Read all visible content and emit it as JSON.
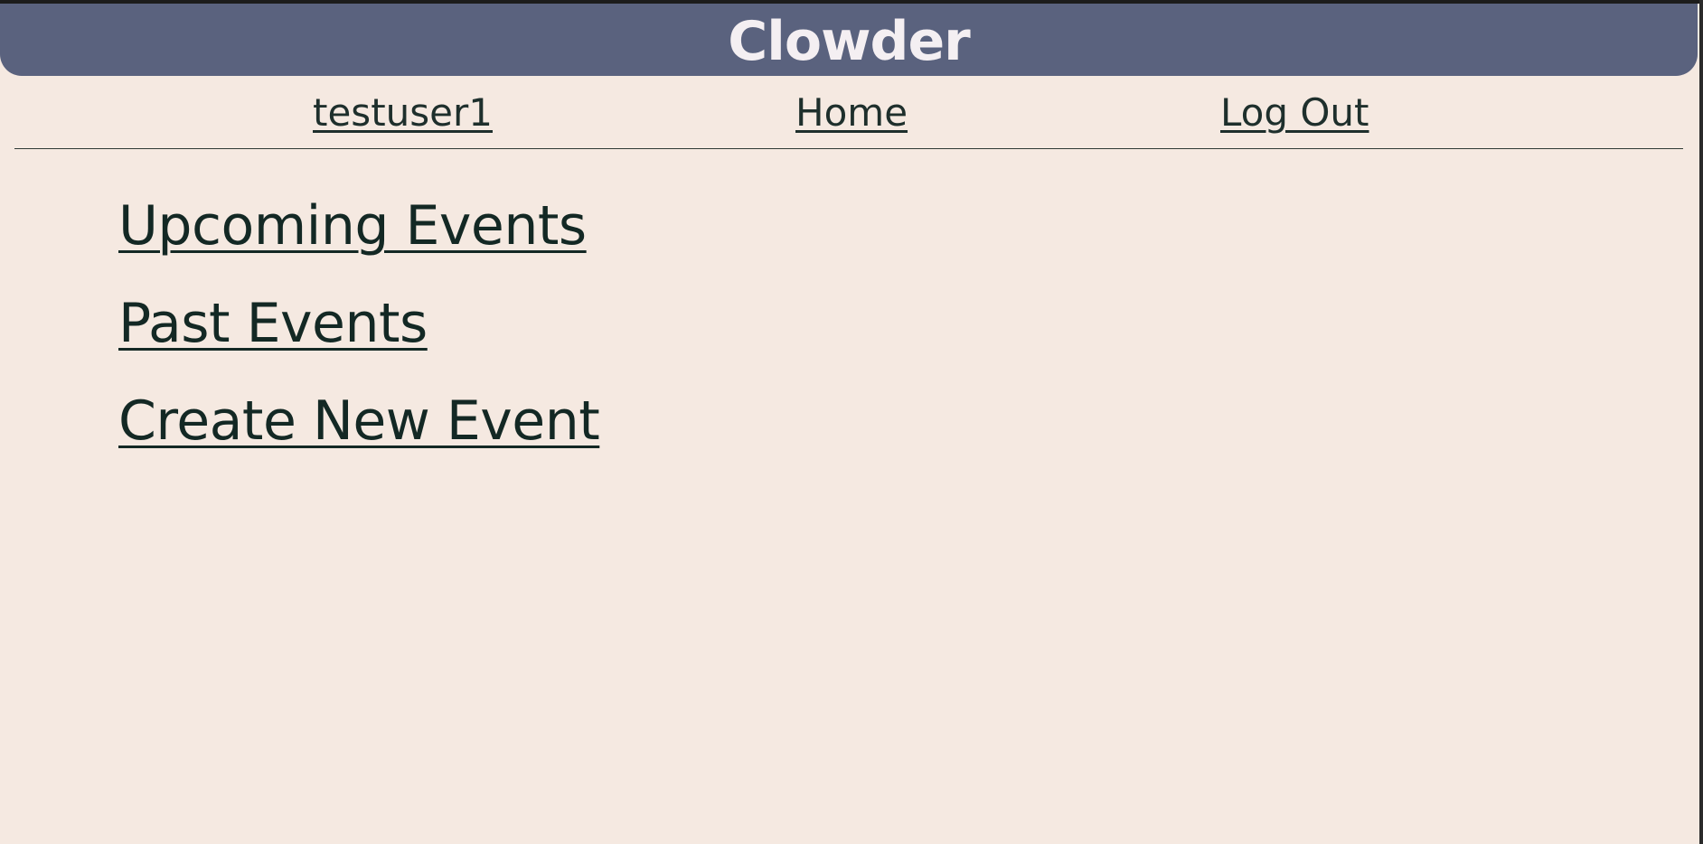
{
  "app": {
    "title": "Clowder"
  },
  "nav": {
    "user_label": "testuser1",
    "home_label": "Home",
    "logout_label": "Log Out"
  },
  "menu": {
    "items": [
      {
        "label": "Upcoming Events"
      },
      {
        "label": "Past Events"
      },
      {
        "label": "Create New Event"
      }
    ]
  },
  "colors": {
    "header_bg": "#5a627e",
    "page_bg": "#f5e9e1",
    "link_text": "#1e2f2c",
    "header_text": "#f4eff2"
  }
}
